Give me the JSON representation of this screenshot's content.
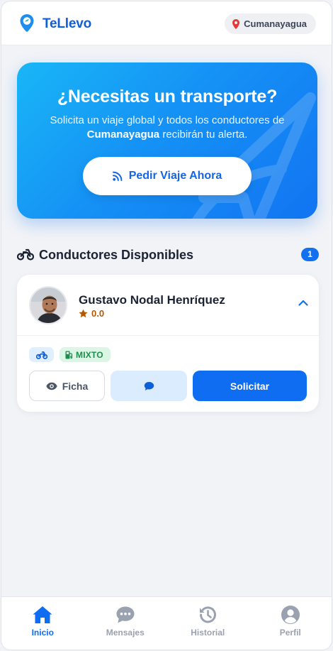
{
  "header": {
    "brand": "TeLlevo",
    "location": "Cumanayagua",
    "logo_icon": "location-pin-logo-icon",
    "brand_color": "#0f5fd6"
  },
  "hero": {
    "title": "¿Necesitas un transporte?",
    "subtitle_prefix": "Solicita un viaje global y todos los conductores de ",
    "subtitle_town": "Cumanayagua",
    "subtitle_suffix": " recibirán tu alerta.",
    "button_label": "Pedir Viaje Ahora",
    "button_icon": "broadcast-icon",
    "gradient": [
      "#19b6f6",
      "#1274f2"
    ]
  },
  "drivers_section": {
    "title": "Conductores Disponibles",
    "count": "1",
    "icon": "motorcycle-icon"
  },
  "drivers": [
    {
      "name": "Gustavo Nodal Henríquez",
      "rating": "0.0",
      "vehicle_tag_icon": "motorcycle-icon",
      "fuel_tag": "MIXTO",
      "actions": {
        "profile_label": "Ficha",
        "message_icon": "chat-bubble-icon",
        "request_label": "Solicitar"
      }
    }
  ],
  "bottom_nav": {
    "items": [
      {
        "label": "Inicio",
        "icon": "home-icon",
        "active": true
      },
      {
        "label": "Mensajes",
        "icon": "messages-icon",
        "active": false
      },
      {
        "label": "Historial",
        "icon": "history-icon",
        "active": false
      },
      {
        "label": "Perfil",
        "icon": "profile-icon",
        "active": false
      }
    ],
    "active_color": "#0f6df2",
    "inactive_color": "#9aa2b0"
  }
}
